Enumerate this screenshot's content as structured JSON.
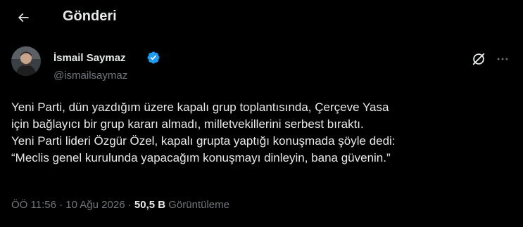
{
  "header": {
    "title": "Gönderi",
    "back_icon": "arrow-left-icon"
  },
  "author": {
    "display_name": "İsmail Saymaz",
    "handle": "@ismailsaymaz",
    "verified_icon": "verified-badge-icon",
    "verified_color": "#1d9bf0"
  },
  "actions": {
    "grok_icon": "grok-icon",
    "more_icon": "more-dots-icon"
  },
  "tweet": {
    "lines": [
      "Yeni Parti, dün yazdığım üzere kapalı grup toplantısında, Çerçeve Yasa",
      "için bağlayıcı bir grup kararı almadı, milletvekillerini serbest bıraktı.",
      "Yeni Parti lideri Özgür Özel, kapalı grupta yaptığı konuşmada şöyle dedi:",
      "“Meclis genel kurulunda yapacağım konuşmayı dinleyin, bana güvenin.”"
    ]
  },
  "meta": {
    "time": "ÖÖ 11:56",
    "separator": "·",
    "date": "10 Ağu 2026",
    "views_count": "50,5 B",
    "views_label": "Görüntüleme"
  },
  "colors": {
    "background": "#000000",
    "text_primary": "#e7e9ea",
    "text_secondary": "#71767b",
    "accent": "#1d9bf0"
  }
}
